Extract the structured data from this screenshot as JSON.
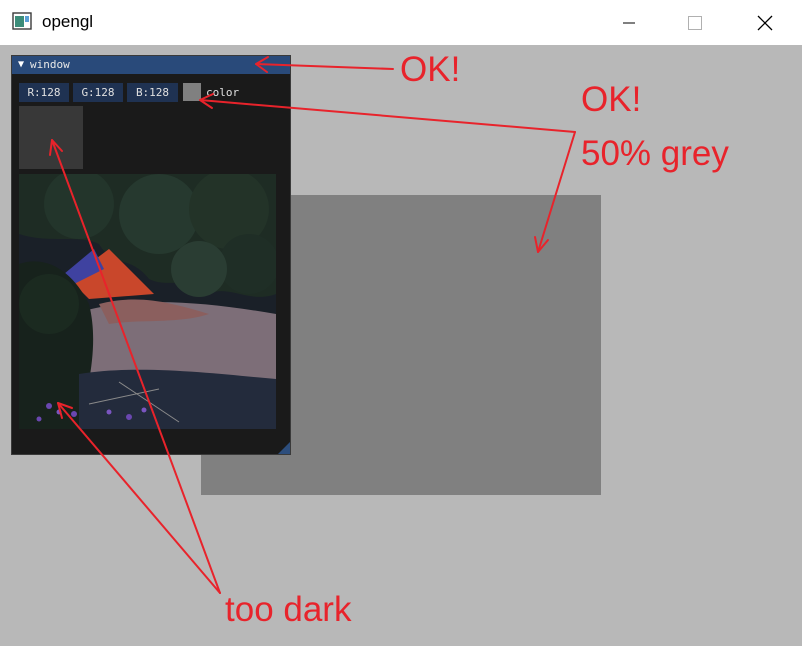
{
  "window": {
    "title": "opengl",
    "icon": "app-window-icon",
    "controls": [
      "minimize-icon",
      "maximize-icon",
      "close-icon"
    ]
  },
  "imgui": {
    "title": "window",
    "collapse_icon": "collapse-arrow-icon",
    "r_value": "R:128",
    "g_value": "G:128",
    "b_value": "B:128",
    "color_label": "color",
    "swatch_color": "#808080"
  },
  "annotations": {
    "ok_title": "OK!",
    "ok_color": "OK!",
    "grey_note": "50% grey",
    "dark_note": "too dark"
  },
  "colors": {
    "background": "#b8b8b8",
    "quad": "#808080",
    "annotation": "#e8232b",
    "imgui_title": "#294a7a"
  }
}
